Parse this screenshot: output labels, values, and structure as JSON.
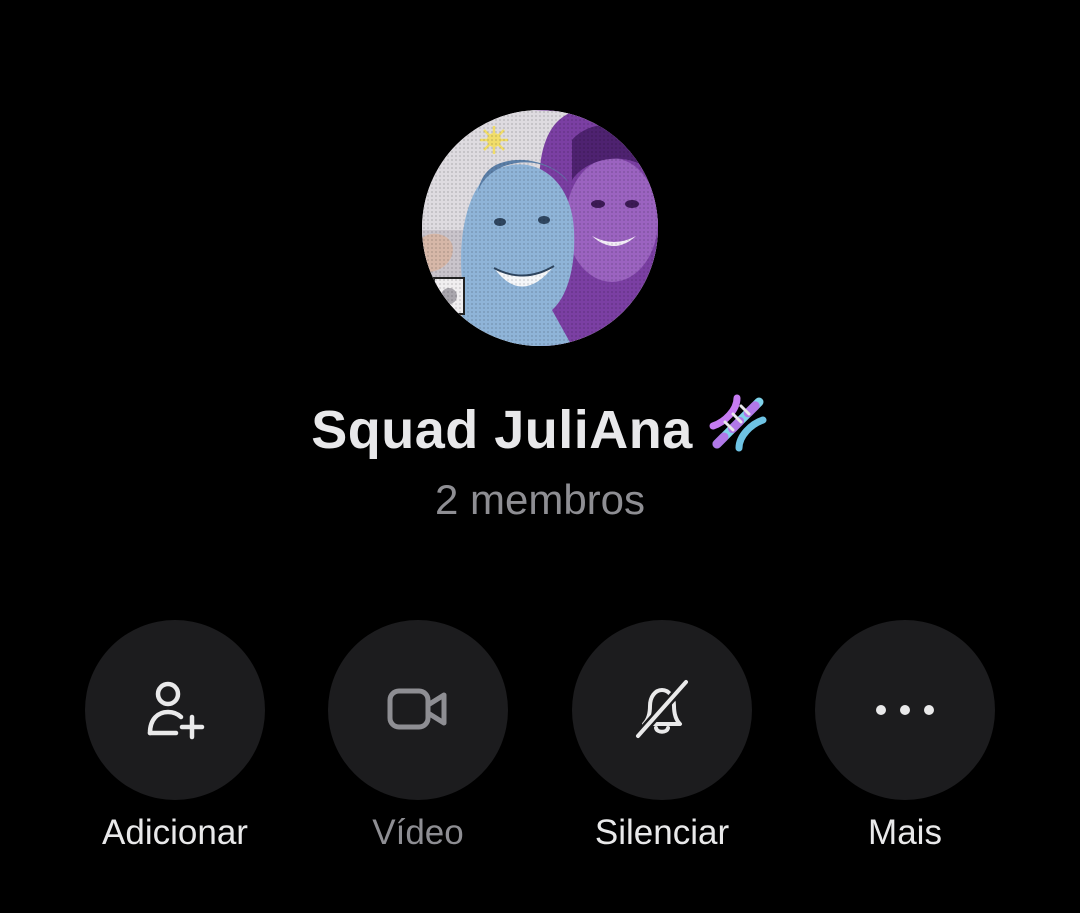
{
  "group": {
    "name": "Squad JuliAna",
    "emoji_icon": "dna-emoji-icon",
    "members": "2 membros"
  },
  "actions": [
    {
      "label": "Adicionar",
      "icon": "add-person-icon",
      "enabled": true
    },
    {
      "label": "Vídeo",
      "icon": "video-camera-icon",
      "enabled": false
    },
    {
      "label": "Silenciar",
      "icon": "bell-slash-icon",
      "enabled": true
    },
    {
      "label": "Mais",
      "icon": "more-dots-icon",
      "enabled": true
    }
  ],
  "colors": {
    "background": "#000000",
    "button_background": "#1c1c1e",
    "primary_text": "#e9e9ea",
    "secondary_text": "#8e8e93",
    "avatar_tint_purple": "#7a3fa0",
    "avatar_tint_blue": "#8fb4d8"
  }
}
